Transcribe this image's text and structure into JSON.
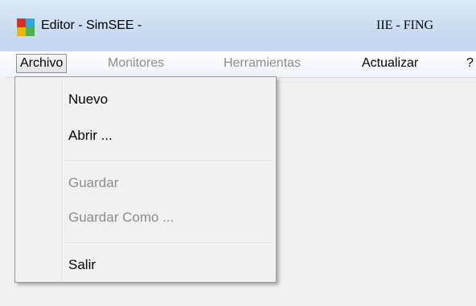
{
  "window": {
    "title": "Editor - SimSEE -",
    "org": "IIE - FING",
    "icon": "simsee-app-icon",
    "icon_colors": [
      "#e62b1e",
      "#2aa9e0",
      "#f4b400",
      "#4caf50"
    ]
  },
  "menubar": {
    "items": [
      {
        "label": "Archivo",
        "state": "active"
      },
      {
        "label": "Monitores",
        "state": "disabled"
      },
      {
        "label": "Herramientas",
        "state": "disabled"
      },
      {
        "label": "Actualizar",
        "state": "enabled"
      },
      {
        "label": "?",
        "state": "enabled"
      }
    ]
  },
  "archivo_menu": {
    "items": [
      {
        "label": "Nuevo",
        "enabled": true
      },
      {
        "label": "Abrir ...",
        "enabled": true
      },
      {
        "label": "Guardar",
        "enabled": false
      },
      {
        "label": "Guardar Como ...",
        "enabled": false
      },
      {
        "label": "Salir",
        "enabled": true
      }
    ]
  }
}
